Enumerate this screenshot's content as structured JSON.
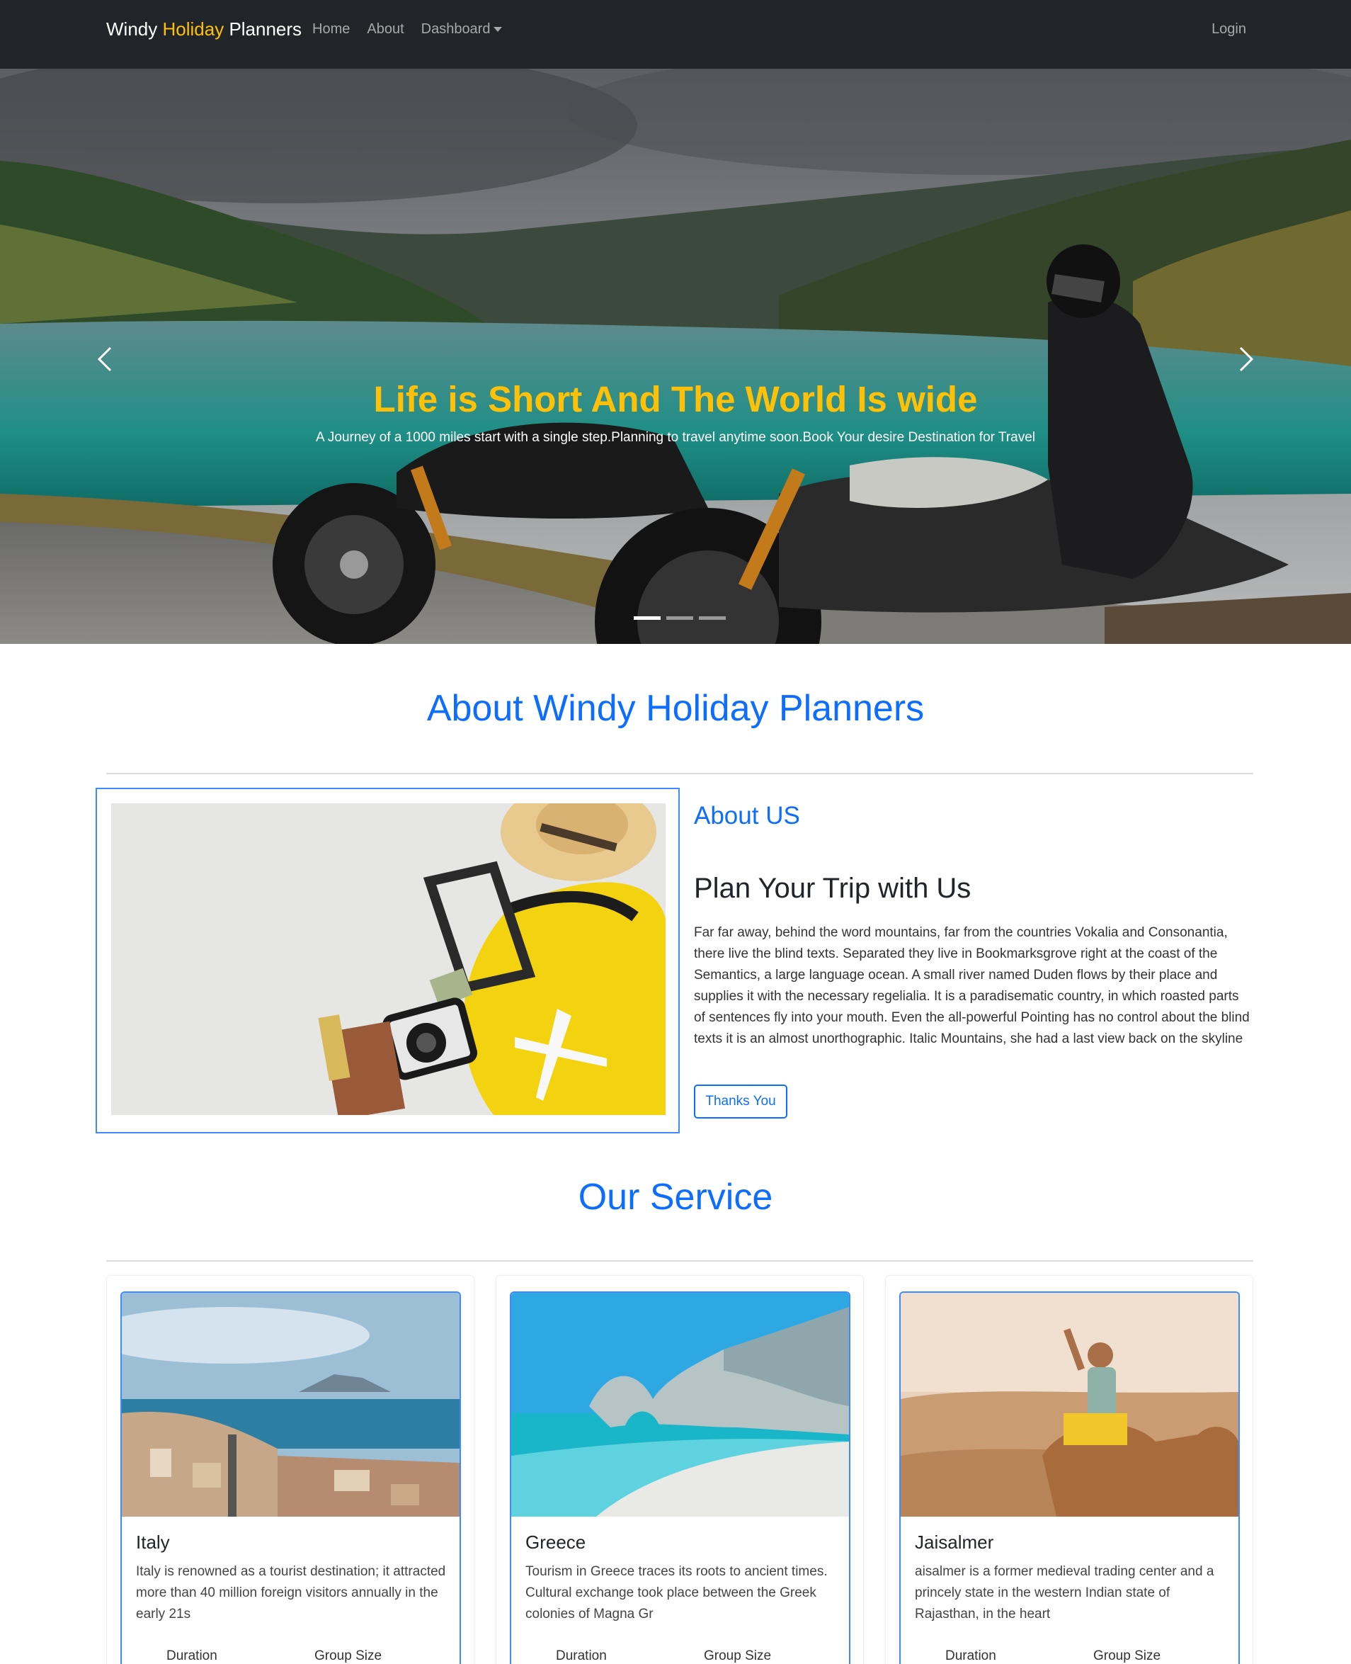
{
  "navbar": {
    "brand_part1": "Windy",
    "brand_part2": "Holiday",
    "brand_part3": "Planners",
    "links": [
      "Home",
      "About",
      "Dashboard"
    ],
    "login": "Login"
  },
  "hero": {
    "title": "Life is Short And The World Is wide",
    "subtitle": "A Journey of a 1000 miles start with a single step.Planning to travel anytime soon.Book Your desire Destination for Travel",
    "slides_total": 3,
    "active_slide": 1
  },
  "about": {
    "section_title": "About Windy Holiday Planners",
    "heading": "About US",
    "subheading": "Plan Your Trip with Us",
    "text": "Far far away, behind the word mountains, far from the countries Vokalia and Consonantia, there live the blind texts. Separated they live in Bookmarksgrove right at the coast of the Semantics, a large language ocean. A small river named Duden flows by their place and supplies it with the necessary regelialia. It is a paradisematic country, in which roasted parts of sentences fly into your mouth. Even the all-powerful Pointing has no control about the blind texts it is an almost unorthographic. Italic Mountains, she had a last view back on the skyline",
    "button": "Thanks You"
  },
  "service": {
    "section_title": "Our Service",
    "cards": [
      {
        "title": "Italy",
        "text": "Italy is renowned as a tourist destination; it attracted more than 40 million foreign visitors annually in the early 21s",
        "duration_label": "Duration",
        "group_label": "Group Size"
      },
      {
        "title": "Greece",
        "text": "Tourism in Greece traces its roots to ancient times. Cultural exchange took place between the Greek colonies of Magna Gr",
        "duration_label": "Duration",
        "group_label": "Group Size"
      },
      {
        "title": "Jaisalmer",
        "text": "aisalmer is a former medieval trading center and a princely state in the western Indian state of Rajasthan, in the heart",
        "duration_label": "Duration",
        "group_label": "Group Size"
      }
    ]
  },
  "colors": {
    "navbar_bg": "#212529",
    "brand_accent": "#ffc107",
    "primary": "#0d6efd"
  }
}
